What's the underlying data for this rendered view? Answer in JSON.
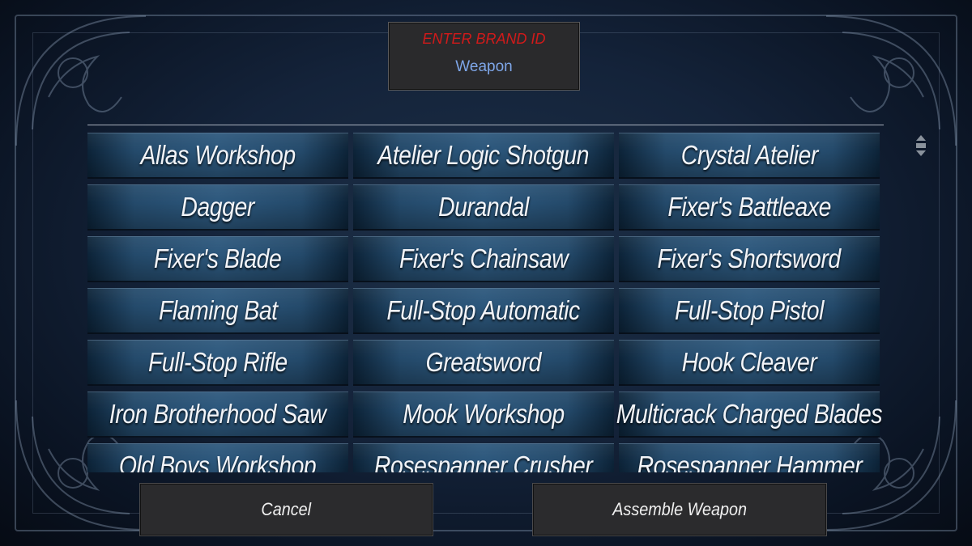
{
  "header": {
    "title": "ENTER BRAND ID",
    "subtitle": "Weapon"
  },
  "weapons": [
    [
      "Allas Workshop",
      "Atelier Logic Shotgun",
      "Crystal Atelier"
    ],
    [
      "Dagger",
      "Durandal",
      "Fixer's Battleaxe"
    ],
    [
      "Fixer's Blade",
      "Fixer's Chainsaw",
      "Fixer's Shortsword"
    ],
    [
      "Flaming Bat",
      "Full-Stop Automatic",
      "Full-Stop Pistol"
    ],
    [
      "Full-Stop Rifle",
      "Greatsword",
      "Hook Cleaver"
    ],
    [
      "Iron Brotherhood Saw",
      "Mook Workshop",
      "Multicrack Charged Blades"
    ],
    [
      "Old Boys Workshop",
      "Rosespanner Crusher",
      "Rosespanner Hammer"
    ]
  ],
  "buttons": {
    "cancel": "Cancel",
    "assemble": "Assemble Weapon"
  },
  "colors": {
    "title_red": "#d11a1a",
    "subtitle_blue": "#7ea6e8",
    "cell_blue": "#2c577c"
  },
  "icons": {
    "scroll": "scroll-updown-icon"
  }
}
